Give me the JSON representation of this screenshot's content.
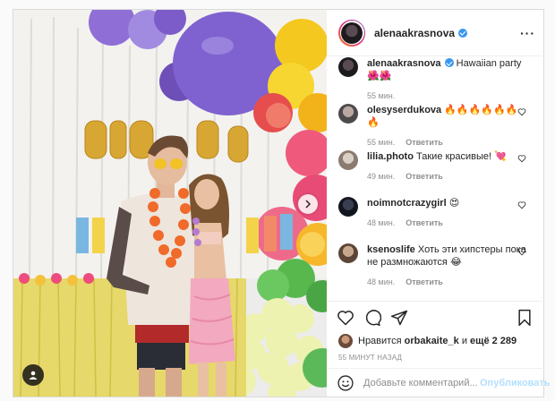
{
  "post": {
    "author": "alenaakrasnova",
    "caption": {
      "username": "alenaakrasnova",
      "text": "Hawaiian party 🌺🌺",
      "time": "55 мин."
    },
    "comments": [
      {
        "username": "olesyserdukova",
        "text": "🔥🔥🔥🔥🔥🔥🔥",
        "time": "55 мин.",
        "reply": "Ответить"
      },
      {
        "username": "lilia.photo",
        "text": "Такие красивые! 💘",
        "time": "49 мин.",
        "reply": "Ответить"
      },
      {
        "username": "noimnotcrazygirl",
        "text": "😍",
        "time": "48 мин.",
        "reply": "Ответить"
      },
      {
        "username": "ksenoslife",
        "text": "Хоть эти хипстеры пока не размножаются 😂",
        "time": "48 мин.",
        "reply": "Ответить"
      }
    ],
    "likes": {
      "prefix": "Нравится",
      "user": "orbakaite_k",
      "suffix": "и",
      "count": "ещё 2 289"
    },
    "posted_ago": "55 МИНУТ НАЗАД",
    "add_comment": {
      "placeholder": "Добавьте комментарий...",
      "publish": "Опубликовать"
    }
  },
  "icons": {
    "more": "more-horizontal-icon",
    "like": "heart-icon",
    "comment": "comment-icon",
    "share": "paper-plane-icon",
    "save": "bookmark-icon",
    "emoji": "smile-icon",
    "next": "chevron-right-icon",
    "tags": "user-tag-icon"
  },
  "colors": {
    "accent": "#3897f0",
    "publish_disabled": "#b2dffc",
    "meta": "#8e8e8e"
  }
}
